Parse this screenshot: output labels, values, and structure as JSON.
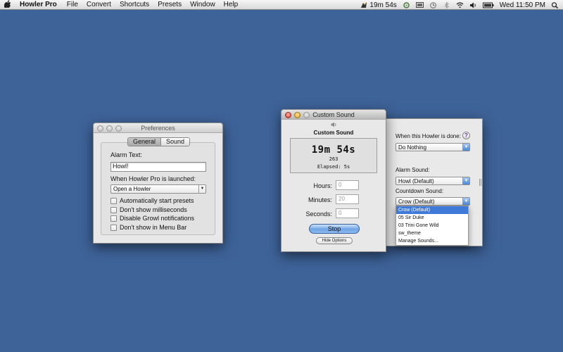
{
  "menubar": {
    "app_name": "Howler Pro",
    "menus": [
      "File",
      "Convert",
      "Shortcuts",
      "Presets",
      "Window",
      "Help"
    ],
    "timer_status": "19m 54s",
    "clock": "Wed 11:50 PM"
  },
  "preferences": {
    "title": "Preferences",
    "tabs": [
      "General",
      "Sound"
    ],
    "selected_tab": "General",
    "alarm_text_label": "Alarm Text:",
    "alarm_text_value": "Howl!",
    "launch_label": "When Howler Pro is launched:",
    "launch_value": "Open a Howler",
    "options": [
      "Automatically start presets",
      "Don't show milliseconds",
      "Disable Growl notifications",
      "Don't show in Menu Bar"
    ]
  },
  "custom_sound": {
    "title": "Custom Sound",
    "header": "Custom Sound",
    "time_display": "19m 54s",
    "count": "263",
    "elapsed": "Elapsed: 5s",
    "hours_label": "Hours:",
    "hours_placeholder": "0",
    "minutes_label": "Minutes:",
    "minutes_placeholder": "20",
    "seconds_label": "Seconds:",
    "seconds_placeholder": "0",
    "stop_label": "Stop",
    "hide_options_label": "Hide Options"
  },
  "options_panel": {
    "done_label": "When this Howler is done:",
    "done_value": "Do Nothing",
    "help_glyph": "?",
    "alarm_sound_label": "Alarm Sound:",
    "alarm_sound_value": "Howl (Default)",
    "countdown_label": "Countdown Sound:",
    "countdown_value": "Crow (Default)",
    "menu_items": [
      "Crow (Default)",
      "05 Sir Duke",
      "03 Trini Gone Wild",
      "sw_theme",
      "Manage Sounds..."
    ],
    "selected_index": 0
  },
  "colors": {
    "desktop": "#3e6399",
    "menu_highlight": "#3f7ad8"
  }
}
